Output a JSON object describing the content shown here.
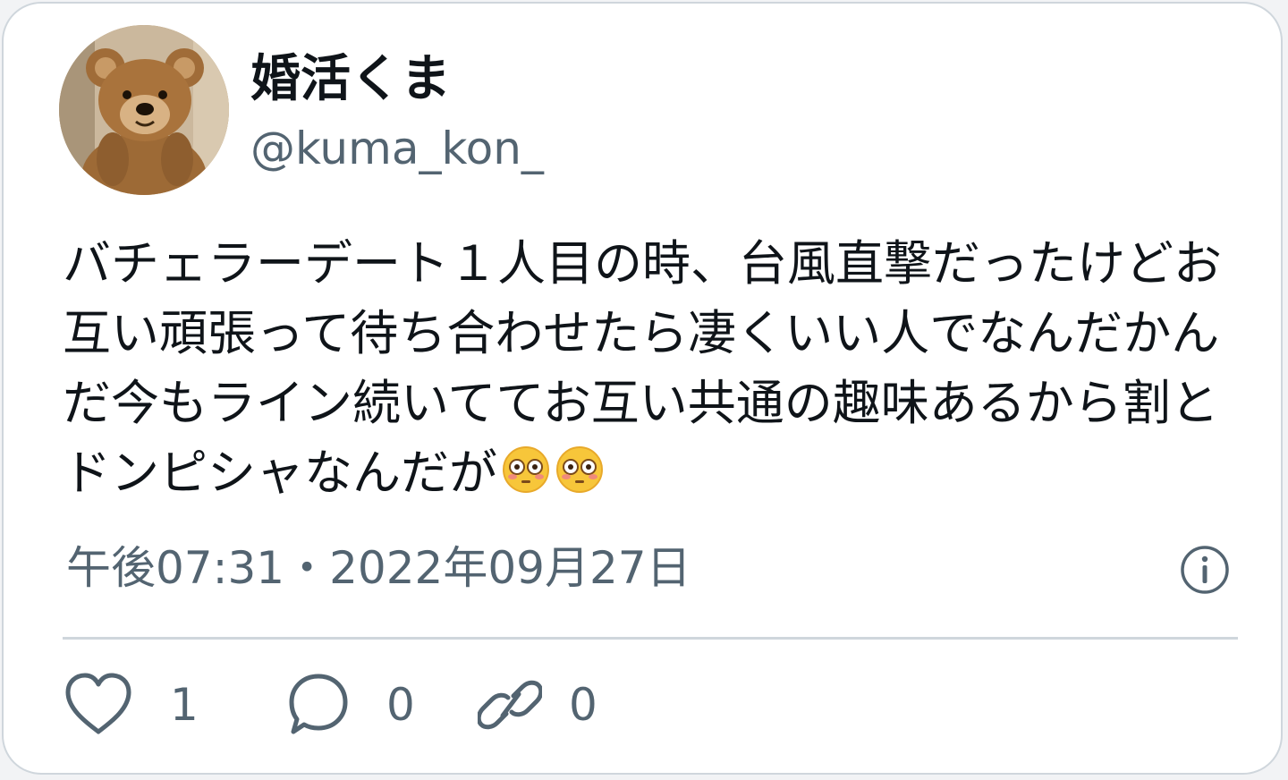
{
  "author": {
    "display_name": "婚活くま",
    "handle": "@kuma_kon_",
    "avatar_icon": "teddy-bear-avatar"
  },
  "tweet": {
    "text": "バチェラーデート１人目の時、台風直撃だったけどお互い頑張って待ち合わせたら凄くいい人でなんだかんだ今もライン続いててお互い共通の趣味あるから割とドンピシャなんだが",
    "emojis": [
      "flushed-face-icon",
      "flushed-face-icon"
    ],
    "timestamp": "午後07:31・2022年09月27日"
  },
  "actions": {
    "like_icon": "heart-icon",
    "like_count": "1",
    "reply_icon": "speech-bubble-icon",
    "reply_count": "0",
    "link_icon": "link-icon",
    "link_count": "0",
    "info_icon": "info-icon"
  },
  "colors": {
    "text": "#0f1419",
    "secondary": "#536471",
    "border": "#cfd6dc",
    "emoji_yellow": "#f7c63a"
  }
}
